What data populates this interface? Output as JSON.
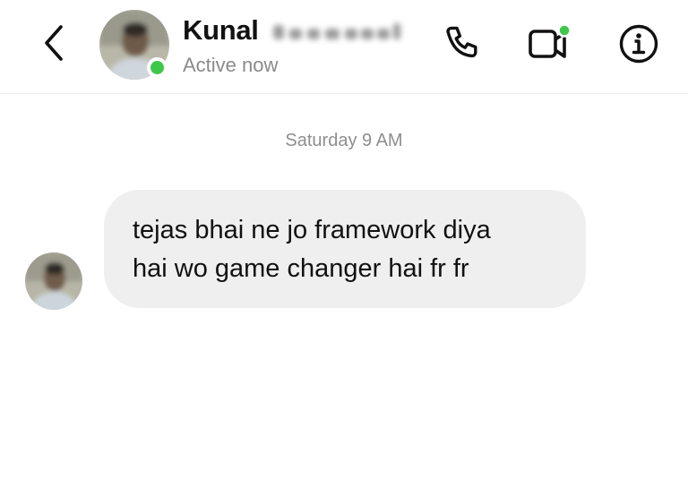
{
  "header": {
    "contact_name": "Kunal",
    "status": "Active now",
    "icons": {
      "back": "chevron-left-icon",
      "call": "phone-icon",
      "video": "video-camera-icon",
      "info": "info-icon"
    }
  },
  "conversation": {
    "timestamp": "Saturday 9 AM",
    "messages": [
      {
        "sender": "contact",
        "text": "tejas bhai ne jo framework diya\nhai wo game changer hai fr fr"
      }
    ]
  },
  "colors": {
    "presence": "#3ec84a",
    "bubble": "#efefef",
    "muted_text": "#8a8a8a",
    "divider": "#ececec"
  }
}
